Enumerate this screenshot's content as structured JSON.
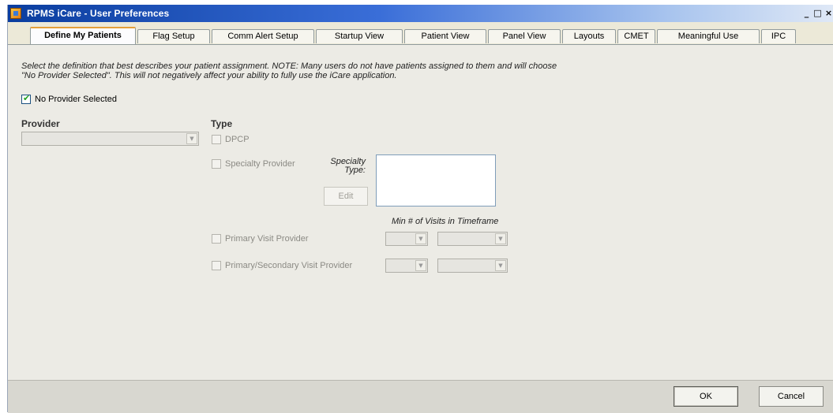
{
  "window": {
    "title": "RPMS iCare - User Preferences",
    "controls": [
      "_",
      "□",
      "×"
    ]
  },
  "tabs": [
    "Define My Patients",
    "Flag Setup",
    "Comm Alert Setup",
    "Startup View",
    "Patient View",
    "Panel View",
    "Layouts",
    "CMET",
    "Meaningful Use",
    "IPC"
  ],
  "active_tab": "Define My Patients",
  "note": {
    "line1": "Select the definition that best describes your patient assignment. NOTE:  Many users do not have patients assigned to them and will choose",
    "line2": "\"No Provider Selected\".  This will not negatively affect your ability to fully use the iCare application."
  },
  "no_provider": {
    "label": "No Provider Selected",
    "checked": true
  },
  "provider": {
    "header": "Provider",
    "value": ""
  },
  "type": {
    "header": "Type",
    "dpcp": "DPCP",
    "specialty_provider": "Specialty Provider",
    "specialty_type_label": "Specialty Type:",
    "edit_button": "Edit",
    "min_visits_label": "Min # of Visits in Timeframe",
    "primary_visit": "Primary Visit Provider",
    "primary_secondary_visit": "Primary/Secondary Visit Provider"
  },
  "footer": {
    "ok": "OK",
    "cancel": "Cancel"
  }
}
